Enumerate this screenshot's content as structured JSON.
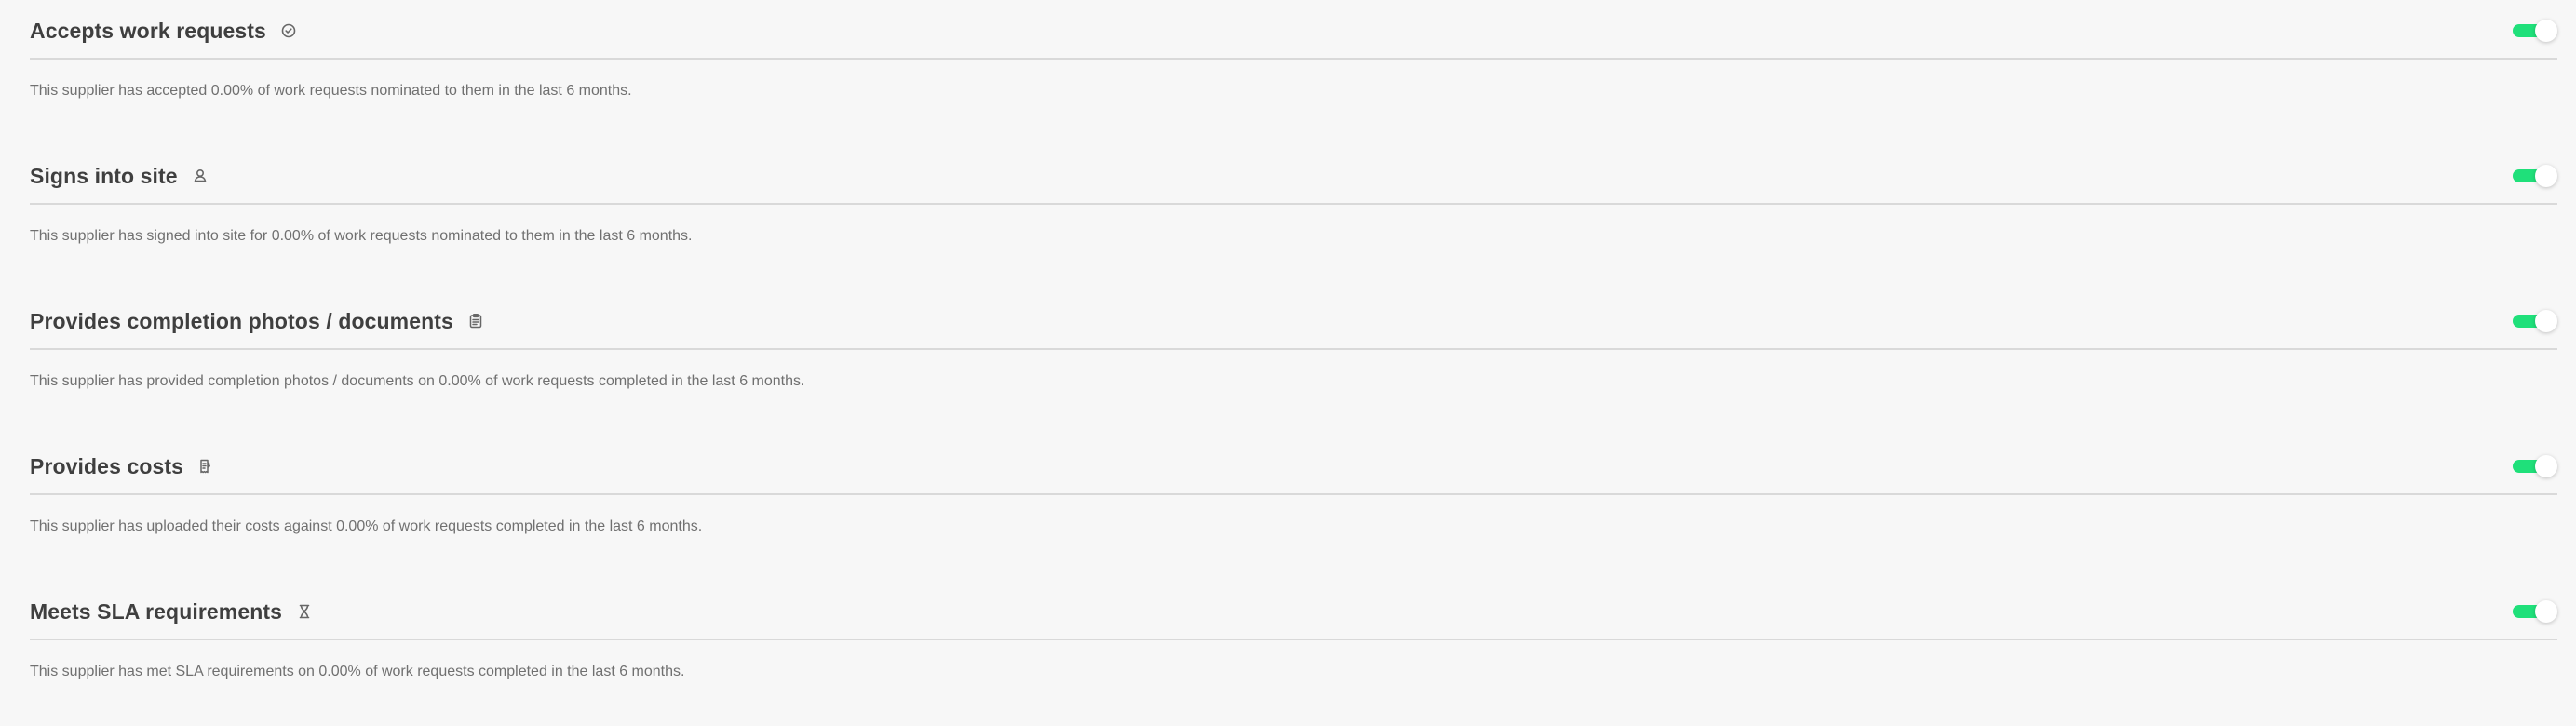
{
  "sections": [
    {
      "title": "Accepts work requests",
      "icon": "check-circle-icon",
      "toggle_state": "on",
      "description": "This supplier has accepted 0.00% of work requests nominated to them in the last 6 months."
    },
    {
      "title": "Signs into site",
      "icon": "user-icon",
      "toggle_state": "on",
      "description": "This supplier has signed into site for 0.00% of work requests nominated to them in the last 6 months."
    },
    {
      "title": "Provides completion photos / documents",
      "icon": "clipboard-icon",
      "toggle_state": "on",
      "description": "This supplier has provided completion photos / documents on 0.00% of work requests completed in the last 6 months."
    },
    {
      "title": "Provides costs",
      "icon": "receipt-icon",
      "toggle_state": "on",
      "description": "This supplier has uploaded their costs against 0.00% of work requests completed in the last 6 months."
    },
    {
      "title": "Meets SLA requirements",
      "icon": "hourglass-icon",
      "toggle_state": "on",
      "description": "This supplier has met SLA requirements on 0.00% of work requests completed in the last 6 months."
    }
  ],
  "colors": {
    "toggle_on": "#1fe07a",
    "text_primary": "#3f3f3f",
    "text_secondary": "#707070",
    "divider": "#d9d9d9",
    "background": "#f7f7f7"
  }
}
